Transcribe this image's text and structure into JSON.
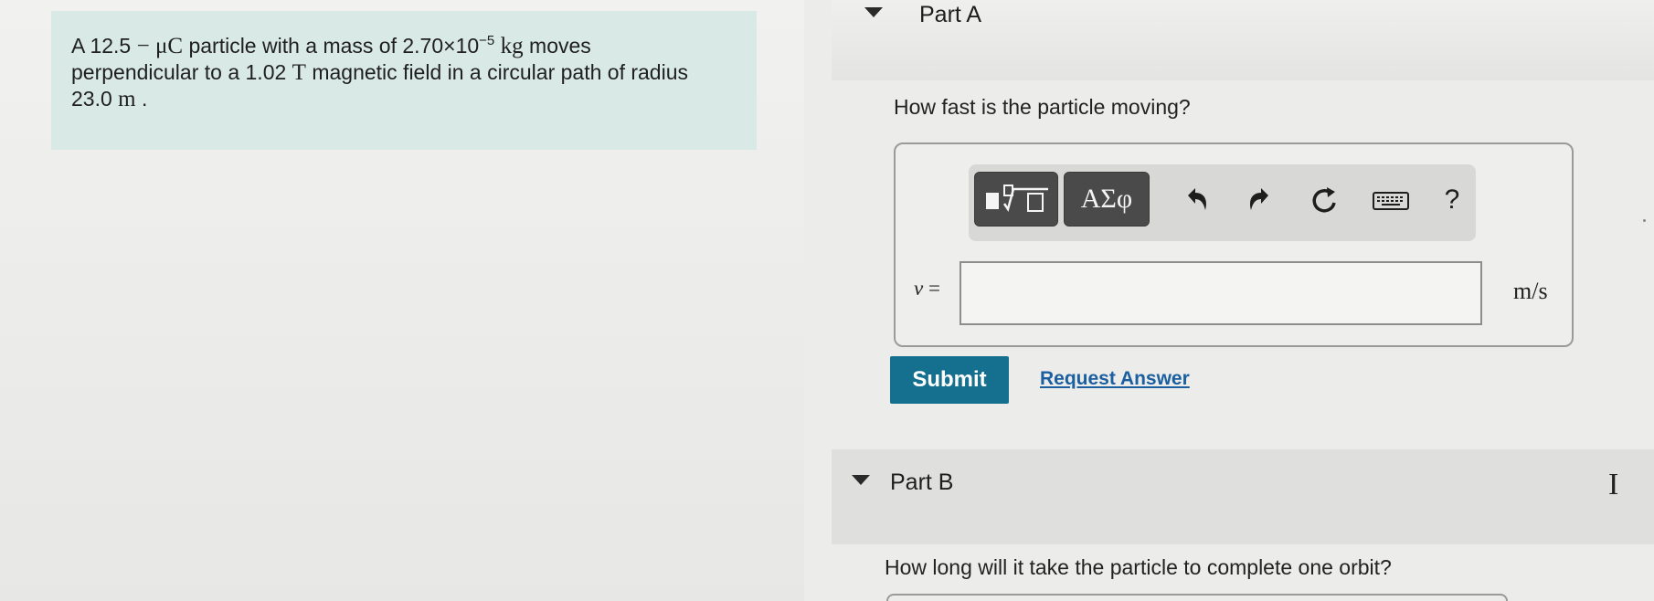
{
  "problem": {
    "intro": "A 12.5",
    "charge_unit": "− μC",
    "mass_pre": " particle with a mass of ",
    "mass_value": "2.70×10",
    "mass_exp": "−5",
    "mass_unit": " kg",
    "mid": " moves perpendicular to a 1.02 ",
    "field_unit": "T",
    "field_post": " magnetic field in a circular path of radius 23.0 ",
    "radius_unit": "m",
    "end": " ."
  },
  "part_a": {
    "title": "Part A",
    "question": "How fast is the particle moving?",
    "toolbar": {
      "templates_icon": "templates-icon",
      "greek_label": "ΑΣφ",
      "undo_icon": "undo-icon",
      "redo_icon": "redo-icon",
      "reset_icon": "reset-icon",
      "keyboard_icon": "keyboard-icon",
      "help_label": "?"
    },
    "variable": "v",
    "equals": "=",
    "input_value": "",
    "unit": "m/s",
    "submit_label": "Submit",
    "request_label": "Request Answer"
  },
  "part_b": {
    "title": "Part B",
    "question": "How long will it take the particle to complete one orbit?"
  },
  "colors": {
    "submit_bg": "#14708e",
    "link": "#1b5fa0",
    "problem_bg": "#d9e9e5"
  }
}
